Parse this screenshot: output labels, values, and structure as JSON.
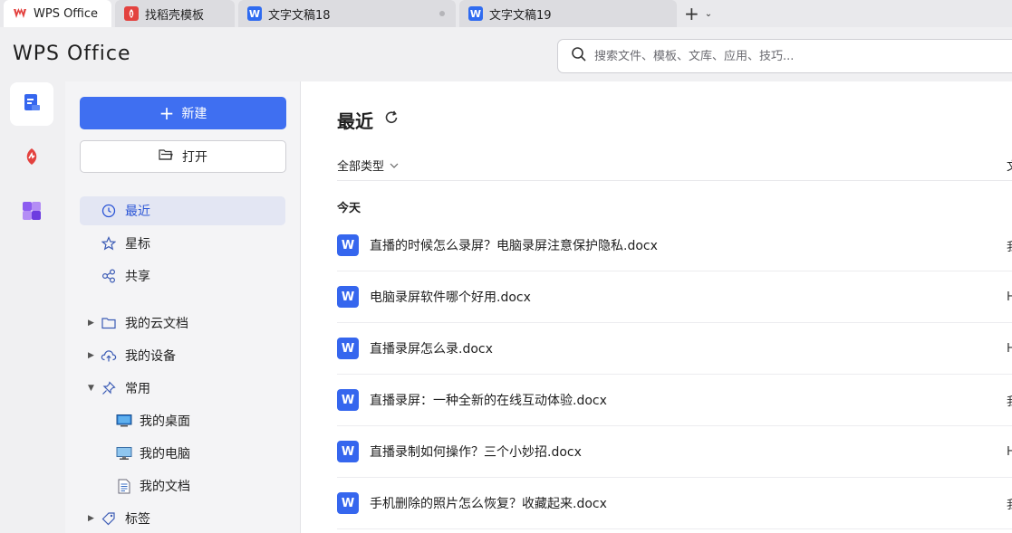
{
  "tabs": [
    {
      "label": "WPS Office",
      "icon": "wps-logo-icon",
      "active": true
    },
    {
      "label": "找稻壳模板",
      "icon": "docer-icon",
      "active": false
    },
    {
      "label": "文字文稿18",
      "icon": "word-doc-icon",
      "active": false,
      "unsaved_dot": true
    },
    {
      "label": "文字文稿19",
      "icon": "word-doc-icon",
      "active": false
    }
  ],
  "new_tab_icon": "plus-icon",
  "app_logo": "WPS Office",
  "search": {
    "placeholder": "搜索文件、模板、文库、应用、技巧..."
  },
  "rail": [
    {
      "icon": "documents-icon",
      "active": true
    },
    {
      "icon": "docer-icon",
      "active": false
    },
    {
      "icon": "apps-icon",
      "active": false
    }
  ],
  "sidebar": {
    "new_label": "新建",
    "open_label": "打开",
    "items": [
      {
        "label": "最近",
        "icon": "clock-icon",
        "active": true
      },
      {
        "label": "星标",
        "icon": "star-icon"
      },
      {
        "label": "共享",
        "icon": "share-icon"
      },
      {
        "label": "我的云文档",
        "icon": "folder-icon",
        "expand": "collapsed"
      },
      {
        "label": "我的设备",
        "icon": "cloud-upload-icon",
        "expand": "collapsed"
      },
      {
        "label": "常用",
        "icon": "pin-icon",
        "expand": "expanded"
      },
      {
        "label": "我的桌面",
        "icon": "desktop-icon"
      },
      {
        "label": "我的电脑",
        "icon": "computer-icon"
      },
      {
        "label": "我的文档",
        "icon": "document-icon"
      },
      {
        "label": "标签",
        "icon": "tag-icon",
        "expand": "collapsed"
      }
    ]
  },
  "main": {
    "title": "最近",
    "filter_label": "全部类型",
    "column_head": "文",
    "group_today": "今天",
    "files": [
      {
        "name": "直播的时候怎么录屏？电脑录屏注意保护隐私.docx",
        "col": "我"
      },
      {
        "name": "电脑录屏软件哪个好用.docx",
        "col": "H"
      },
      {
        "name": "直播录屏怎么录.docx",
        "col": "H"
      },
      {
        "name": "直播录屏：一种全新的在线互动体验.docx",
        "col": "我"
      },
      {
        "name": "直播录制如何操作？三个小妙招.docx",
        "col": "H"
      },
      {
        "name": "手机删除的照片怎么恢复？收藏起来.docx",
        "col": "我"
      }
    ]
  },
  "colors": {
    "accent": "#3f6ff1",
    "word_blue": "#3566ee",
    "docer_red": "#e3423f"
  }
}
